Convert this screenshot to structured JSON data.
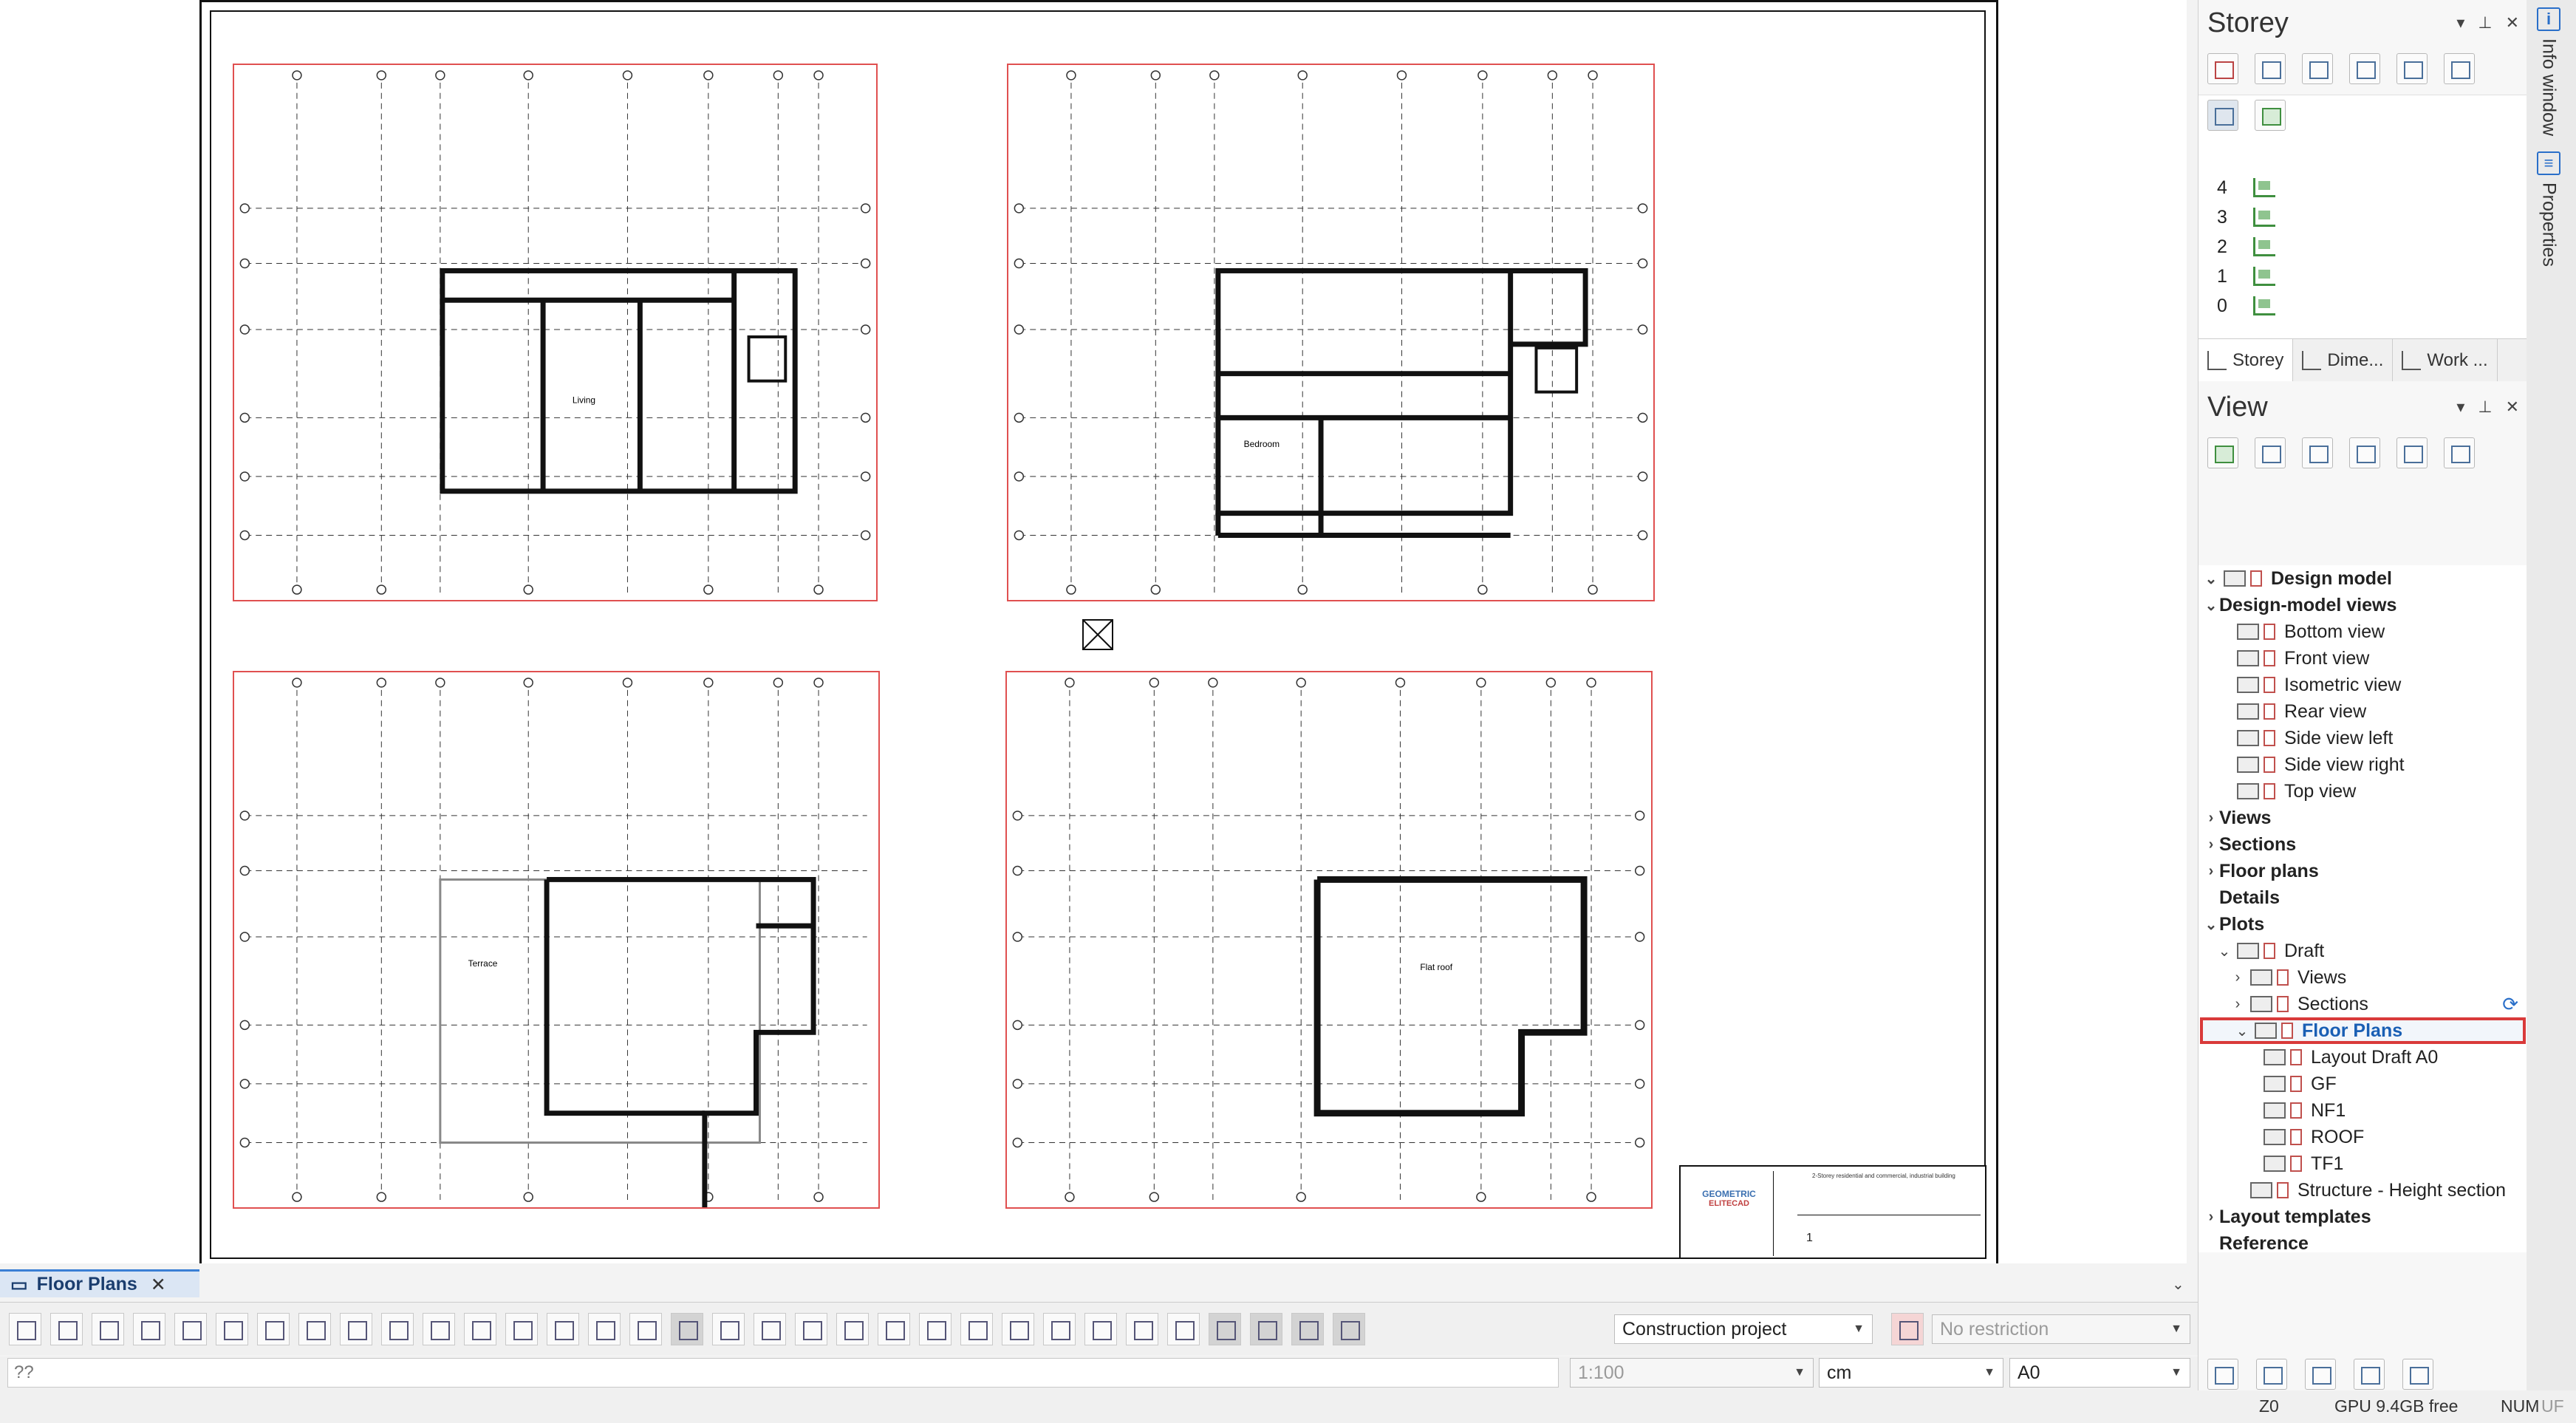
{
  "storey_panel": {
    "title": "Storey",
    "storeys": [
      "4",
      "3",
      "2",
      "1",
      "0"
    ],
    "tabs": [
      "Storey",
      "Dime...",
      "Work ..."
    ]
  },
  "view_panel": {
    "title": "View",
    "tree": [
      {
        "label": "Design model",
        "level": 0,
        "expanded": true
      },
      {
        "label": "Design-model views",
        "level": 0,
        "expanded": true
      },
      {
        "label": "Bottom view",
        "level": 1
      },
      {
        "label": "Front view",
        "level": 1
      },
      {
        "label": "Isometric view",
        "level": 1
      },
      {
        "label": "Rear view",
        "level": 1
      },
      {
        "label": "Side view left",
        "level": 1
      },
      {
        "label": "Side view right",
        "level": 1
      },
      {
        "label": "Top view",
        "level": 1
      },
      {
        "label": "Views",
        "level": 0,
        "expanded": false
      },
      {
        "label": "Sections",
        "level": 0,
        "expanded": false
      },
      {
        "label": "Floor plans",
        "level": 0,
        "expanded": false
      },
      {
        "label": "Details",
        "level": 0
      },
      {
        "label": "Plots",
        "level": 0,
        "expanded": true
      },
      {
        "label": "Draft",
        "level": 1,
        "expanded": true
      },
      {
        "label": "Views",
        "level": 2,
        "expanded": false
      },
      {
        "label": "Sections",
        "level": 2,
        "expanded": false
      },
      {
        "label": "Floor Plans",
        "level": 2,
        "expanded": true,
        "selected": true
      },
      {
        "label": "Layout Draft A0",
        "level": 3
      },
      {
        "label": "GF",
        "level": 3
      },
      {
        "label": "NF1",
        "level": 3
      },
      {
        "label": "ROOF",
        "level": 3
      },
      {
        "label": "TF1",
        "level": 3
      },
      {
        "label": "Structure - Height section",
        "level": 2
      },
      {
        "label": "Layout templates",
        "level": 0,
        "expanded": false
      },
      {
        "label": "Reference",
        "level": 0
      }
    ]
  },
  "side_tabs": {
    "info": "Info window",
    "properties": "Properties"
  },
  "document_tab": {
    "label": "Floor Plans"
  },
  "toolbar": {
    "project_combo": "Construction project",
    "restriction_combo": "No restriction",
    "scale_combo": "1:100",
    "unit_combo": "cm",
    "format_combo": "A0"
  },
  "command_line": {
    "value": "??"
  },
  "status": {
    "z": "Z0",
    "gpu": "GPU 9.4GB free",
    "num": "NUM",
    "uf": "UF"
  },
  "titleblock": {
    "brand_line1": "GEOMETRIC",
    "brand_line2": "ELITECAD",
    "description": "2-Storey residential and commercial, industrial building",
    "sheet_no": "1"
  },
  "plans": [
    {
      "name": "plan-ground-floor",
      "annotation": "Living"
    },
    {
      "name": "plan-first-floor",
      "annotation": "Bedroom"
    },
    {
      "name": "plan-second-floor",
      "annotation": "Terrace"
    },
    {
      "name": "plan-roof",
      "annotation": "Flat roof"
    }
  ],
  "colors": {
    "accent": "#3a7fd5",
    "plan_frame": "#e05050",
    "selection": "#d93a3a"
  }
}
